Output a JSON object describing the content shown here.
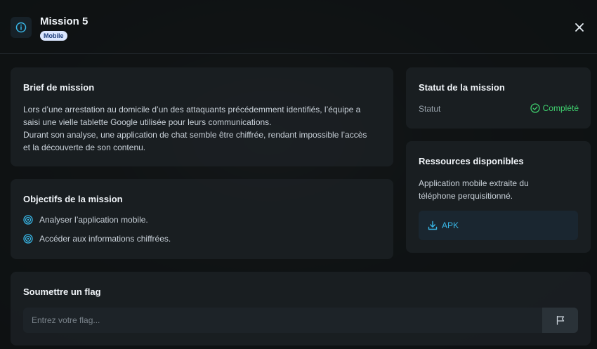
{
  "header": {
    "title": "Mission 5",
    "badge": "Mobile",
    "info_icon": "info-icon",
    "close_icon": "close-icon"
  },
  "brief": {
    "title": "Brief de mission",
    "paragraphs": [
      "Lors d’une arrestation au domicile d’un des attaquants précédemment identifiés, l’équipe a saisi une vielle tablette Google utilisée pour leurs communications.",
      "Durant son analyse, une application de chat semble être chiffrée, rendant impossible l’accès et la découverte de son contenu."
    ]
  },
  "objectives": {
    "title": "Objectifs de la mission",
    "items": [
      "Analyser l’application mobile.",
      "Accéder aux informations chiffrées."
    ],
    "item_icon": "target-icon"
  },
  "status": {
    "title": "Statut de la mission",
    "label": "Statut",
    "value": "Complété",
    "value_icon": "check-circle-icon"
  },
  "resources": {
    "title": "Ressources disponibles",
    "description": "Application mobile extraite du téléphone perquisitionné.",
    "button_label": "APK",
    "button_icon": "download-icon"
  },
  "flag": {
    "title": "Soumettre un flag",
    "placeholder": "Entrez votre flag...",
    "submit_icon": "flag-icon"
  },
  "colors": {
    "accent": "#38b6e6",
    "success": "#3fcf6e",
    "badge_bg": "#dbe7ff"
  }
}
